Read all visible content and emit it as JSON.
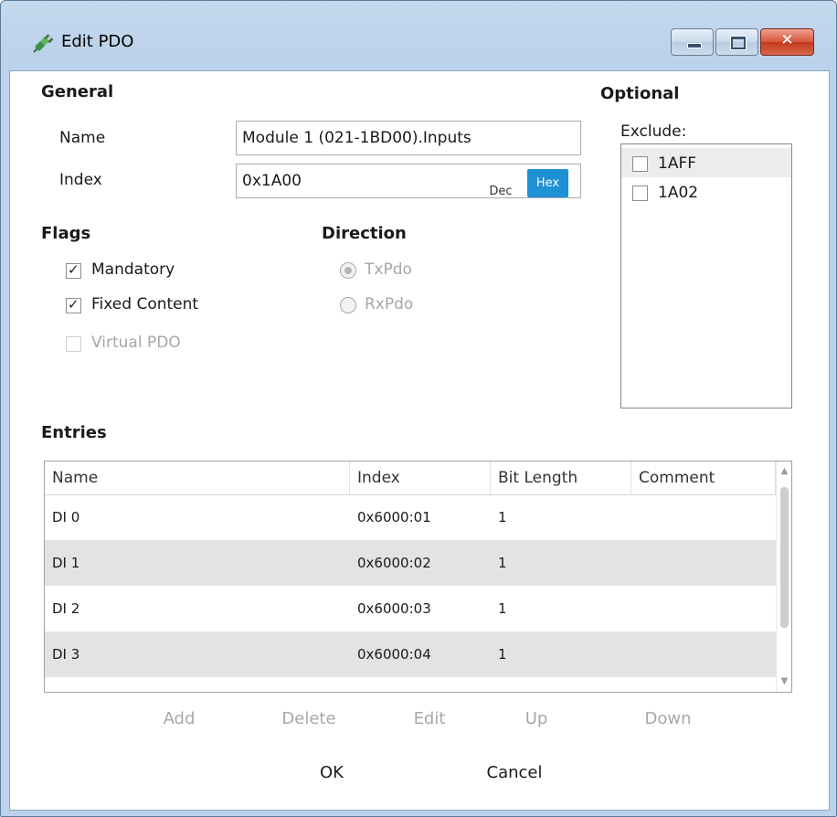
{
  "window": {
    "title": "Edit PDO",
    "close_glyph": "✕",
    "icon": "pdo-plug-icon",
    "accent_color": "#1e90d4"
  },
  "general": {
    "heading": "General",
    "name_label": "Name",
    "name_value": "Module 1 (021-1BD00).Inputs",
    "index_label": "Index",
    "index_value": "0x1A00",
    "dec_label": "Dec",
    "hex_label": "Hex"
  },
  "optional": {
    "heading": "Optional",
    "exclude_label": "Exclude:",
    "items": [
      {
        "label": "1AFF",
        "checked": false
      },
      {
        "label": "1A02",
        "checked": false
      }
    ]
  },
  "flags": {
    "heading": "Flags",
    "mandatory": "Mandatory",
    "fixed_content": "Fixed Content",
    "virtual_pdo": "Virtual PDO"
  },
  "direction": {
    "heading": "Direction",
    "txpdo": "TxPdo",
    "rxpdo": "RxPdo"
  },
  "entries": {
    "heading": "Entries",
    "columns": [
      "Name",
      "Index",
      "Bit Length",
      "Comment"
    ],
    "rows": [
      [
        "DI 0",
        "0x6000:01",
        "1",
        ""
      ],
      [
        "DI 1",
        "0x6000:02",
        "1",
        ""
      ],
      [
        "DI 2",
        "0x6000:03",
        "1",
        ""
      ],
      [
        "DI 3",
        "0x6000:04",
        "1",
        ""
      ]
    ]
  },
  "actions": {
    "add": "Add",
    "delete": "Delete",
    "edit": "Edit",
    "up": "Up",
    "down": "Down",
    "ok": "OK",
    "cancel": "Cancel"
  }
}
